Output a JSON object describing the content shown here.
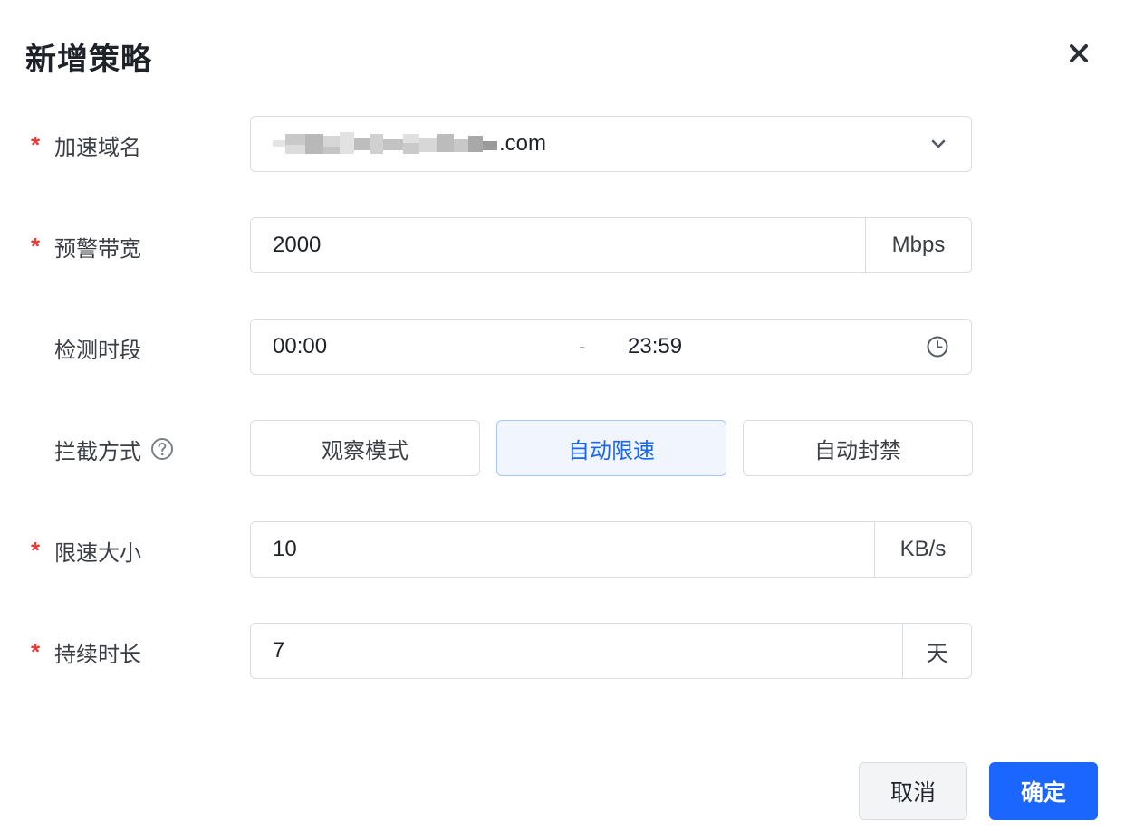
{
  "dialog": {
    "title": "新增策略",
    "close_icon": "close-icon"
  },
  "colors": {
    "required": "#e23b3b",
    "primary": "#1a66ff",
    "active_text": "#1a66f0",
    "active_bg": "#f1f6fe"
  },
  "form": {
    "domain": {
      "label": "加速域名",
      "required": true,
      "value_suffix": ".com",
      "value_redacted": true,
      "icon": "chevron-down-icon"
    },
    "alert_bandwidth": {
      "label": "预警带宽",
      "required": true,
      "value": "2000",
      "unit": "Mbps"
    },
    "detect_period": {
      "label": "检测时段",
      "required": false,
      "start": "00:00",
      "separator": "-",
      "end": "23:59",
      "icon": "clock-icon"
    },
    "block_mode": {
      "label": "拦截方式",
      "required": false,
      "help_icon": "help-circle-icon",
      "options": [
        "观察模式",
        "自动限速",
        "自动封禁"
      ],
      "selected": "自动限速"
    },
    "limit_size": {
      "label": "限速大小",
      "required": true,
      "value": "10",
      "unit": "KB/s"
    },
    "duration": {
      "label": "持续时长",
      "required": true,
      "value": "7",
      "unit": "天"
    },
    "required_mark": "*"
  },
  "footer": {
    "cancel_label": "取消",
    "ok_label": "确定"
  }
}
